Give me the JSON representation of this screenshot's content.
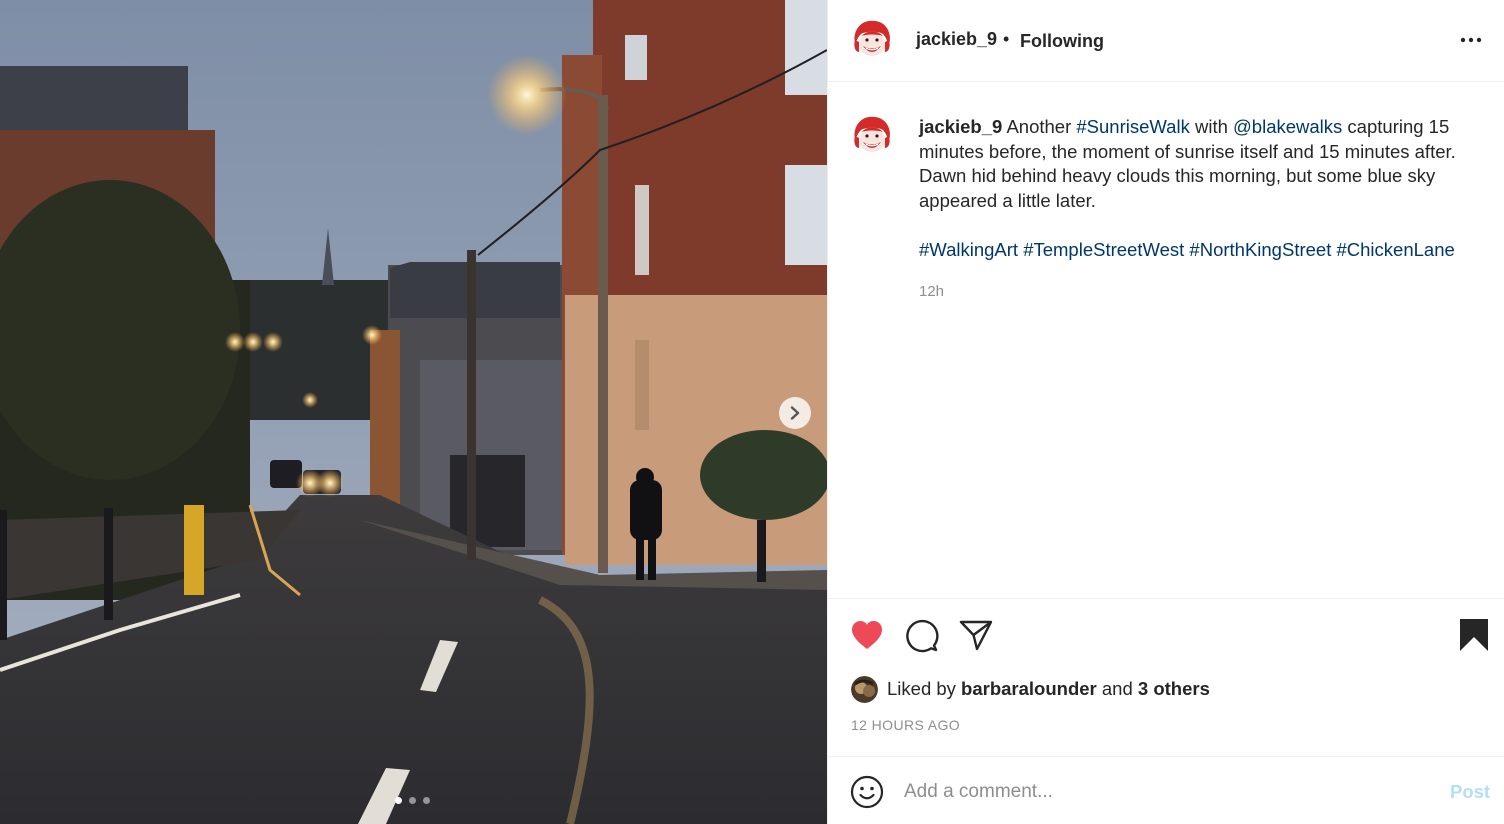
{
  "post": {
    "image_alt_scene": "street at dawn",
    "carousel": {
      "dots": 3,
      "active_index": 0
    },
    "icons": {
      "next": "chevron-right-icon"
    }
  },
  "header": {
    "username": "jackieb_9",
    "separator": "•",
    "follow_status": "Following",
    "more_icon": "more-horizontal-icon"
  },
  "caption": {
    "username": "jackieb_9",
    "text_1": "Another ",
    "hashtag_1": "#SunriseWalk",
    "text_2": " with ",
    "mention": "@blakewalks",
    "text_3": " capturing 15 minutes before, the moment of sunrise itself and 15 minutes after. Dawn hid behind heavy clouds this morning, but some blue sky appeared a little later.",
    "tags": [
      "#WalkingArt",
      "#TempleStreetWest",
      "#NorthKingStreet",
      "#ChickenLane"
    ],
    "time": "12h"
  },
  "actions": {
    "like_icon": "heart-filled-icon",
    "comment_icon": "comment-icon",
    "share_icon": "send-icon",
    "save_icon": "bookmark-filled-icon",
    "like_color": "#ed4956"
  },
  "likes": {
    "prefix": "Liked by ",
    "user": "barbaralounder",
    "middle": " and ",
    "others": "3 others"
  },
  "posted_ago": "12 HOURS AGO",
  "comment": {
    "placeholder": "Add a comment...",
    "post_label": "Post",
    "post_color": "#b2dffc"
  }
}
